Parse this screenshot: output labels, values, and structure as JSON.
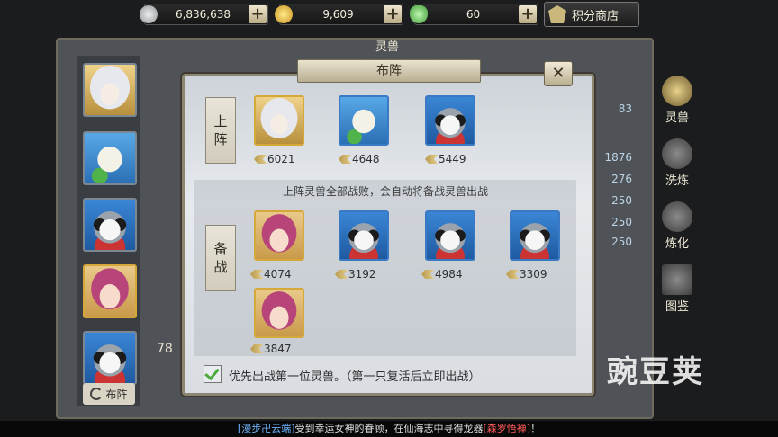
{
  "currency": {
    "silver": "6,836,638",
    "gold": "9,609",
    "jade": "60",
    "plus": "+",
    "shop_label": "积分商店"
  },
  "background": {
    "title": "灵兽",
    "side_tabs": [
      "灵兽",
      "洗炼",
      "炼化",
      "图鉴"
    ],
    "stats": [
      "83",
      "1876",
      "276",
      "250",
      "250",
      "250"
    ],
    "left_number": "78",
    "formation_button": "布阵"
  },
  "dialog": {
    "title": "布阵",
    "close": "✕",
    "active_label": [
      "上",
      "阵"
    ],
    "reserve_label": [
      "备",
      "战"
    ],
    "note": "上阵灵兽全部战败，会自动将备战灵兽出战",
    "active": [
      {
        "portrait": "white-hair-spirit",
        "power": "6021",
        "frame": "gold"
      },
      {
        "portrait": "egg-sprout-spirit",
        "power": "4648",
        "frame": "blue"
      },
      {
        "portrait": "raccoon-spirit",
        "power": "5449",
        "frame": "blue"
      }
    ],
    "reserve": [
      {
        "portrait": "pink-hair-girl",
        "power": "4074",
        "frame": "gold"
      },
      {
        "portrait": "raccoon-spirit",
        "power": "3192",
        "frame": "blue"
      },
      {
        "portrait": "raccoon-spirit",
        "power": "4984",
        "frame": "blue"
      },
      {
        "portrait": "raccoon-spirit",
        "power": "3309",
        "frame": "blue"
      },
      {
        "portrait": "pink-hair-girl",
        "power": "3847",
        "frame": "gold"
      }
    ],
    "checkbox_label": "优先出战第一位灵兽。（第一只复活后立即出战）",
    "checkbox_checked": true
  },
  "banner": {
    "name": "[漫步卍云端]",
    "text": "受到幸运女神的眷顾，在仙海志中寻得龙器",
    "item": "[森罗悟禅]",
    "end": "！"
  },
  "watermark": "豌豆荚"
}
